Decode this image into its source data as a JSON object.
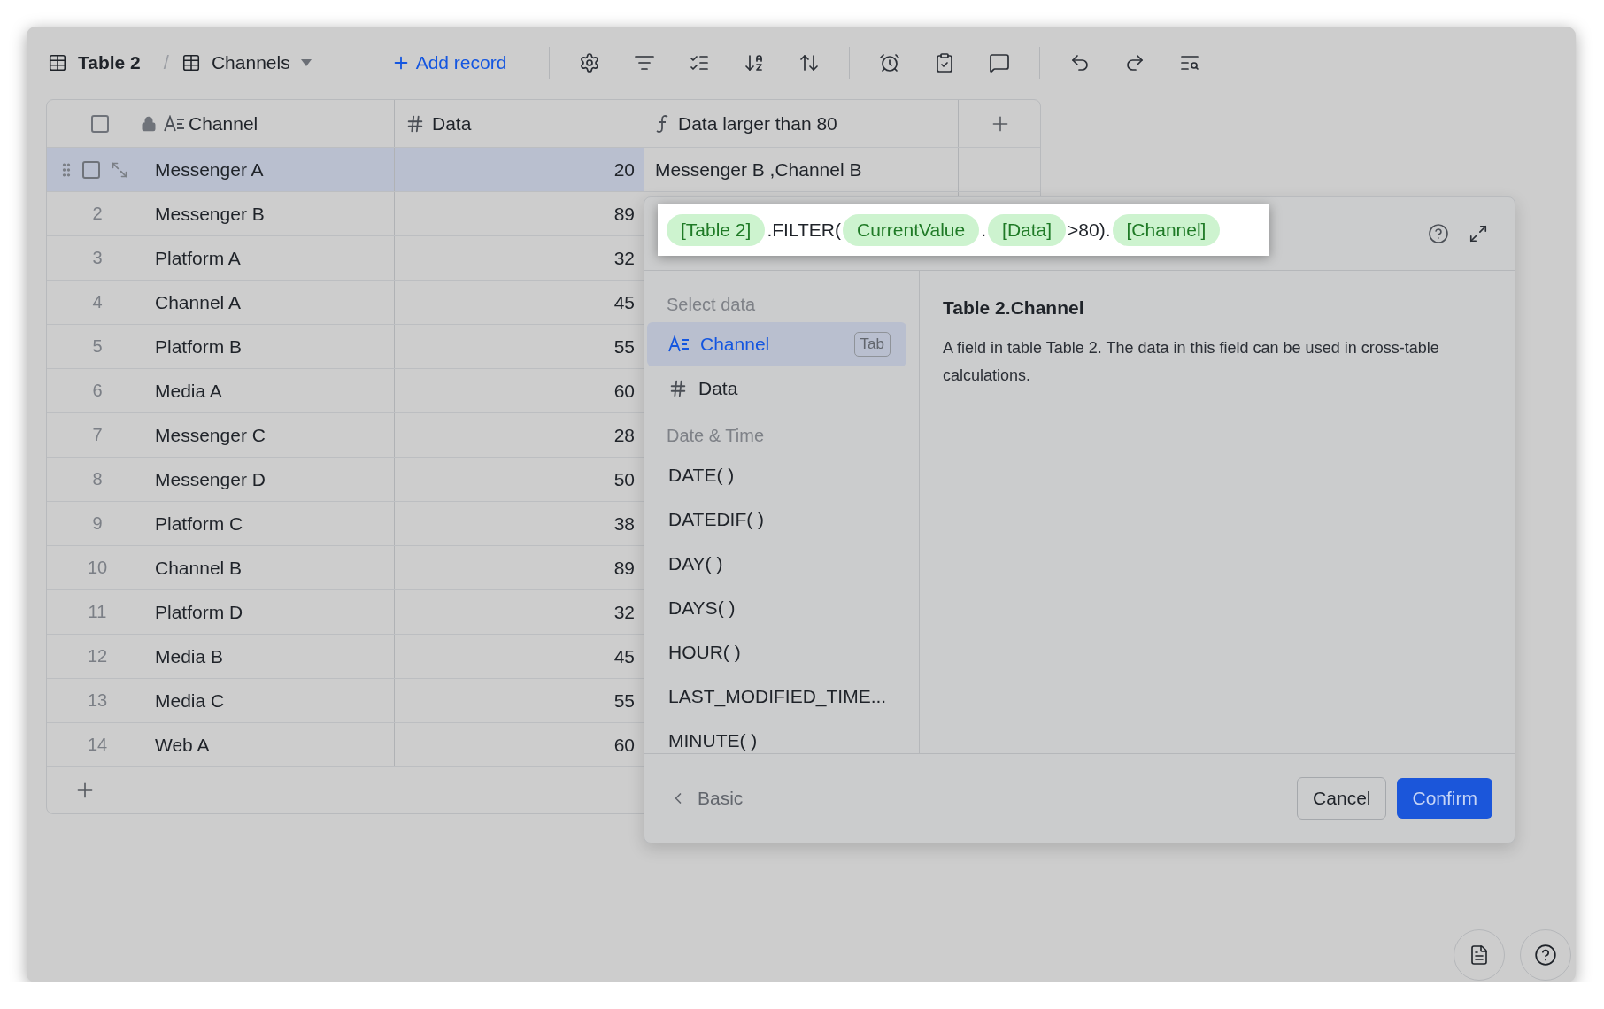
{
  "toolbar": {
    "table_name": "Table 2",
    "separator": "/",
    "view_name": "Channels",
    "add_record": "Add record"
  },
  "table": {
    "all_checked": false,
    "columns": [
      {
        "kind": "text",
        "label": "Channel"
      },
      {
        "kind": "number",
        "label": "Data"
      },
      {
        "kind": "formula",
        "label": "Data larger than 80"
      }
    ],
    "rows": [
      {
        "selected": true,
        "checked": false,
        "channel": "Messenger A",
        "data": "20",
        "formula": "Messenger B ,Channel B"
      },
      {
        "selected": false,
        "index": "2",
        "channel": "Messenger B",
        "data": "89"
      },
      {
        "selected": false,
        "index": "3",
        "channel": "Platform A",
        "data": "32"
      },
      {
        "selected": false,
        "index": "4",
        "channel": "Channel A",
        "data": "45"
      },
      {
        "selected": false,
        "index": "5",
        "channel": "Platform B",
        "data": "55"
      },
      {
        "selected": false,
        "index": "6",
        "channel": "Media A",
        "data": "60"
      },
      {
        "selected": false,
        "index": "7",
        "channel": "Messenger C",
        "data": "28"
      },
      {
        "selected": false,
        "index": "8",
        "channel": "Messenger D",
        "data": "50"
      },
      {
        "selected": false,
        "index": "9",
        "channel": "Platform C",
        "data": "38"
      },
      {
        "selected": false,
        "index": "10",
        "channel": "Channel B",
        "data": "89"
      },
      {
        "selected": false,
        "index": "11",
        "channel": "Platform D",
        "data": "32"
      },
      {
        "selected": false,
        "index": "12",
        "channel": "Media B",
        "data": "45"
      },
      {
        "selected": false,
        "index": "13",
        "channel": "Media C",
        "data": "55"
      },
      {
        "selected": false,
        "index": "14",
        "channel": "Web A",
        "data": "60"
      }
    ]
  },
  "formula_editor": {
    "tokens": [
      {
        "kind": "ref",
        "text": "[Table 2]"
      },
      {
        "kind": "plain",
        "text": ".FILTER("
      },
      {
        "kind": "ref",
        "text": "CurrentValue"
      },
      {
        "kind": "plain",
        "text": "."
      },
      {
        "kind": "ref",
        "text": "[Data]"
      },
      {
        "kind": "plain",
        "text": ">80)."
      },
      {
        "kind": "ref",
        "text": "[Channel]"
      }
    ],
    "sections": [
      {
        "title": "Select data",
        "items": [
          {
            "kind": "text-field",
            "label": "Channel",
            "shortcut": "Tab",
            "selected": true
          },
          {
            "kind": "number-field",
            "label": "Data",
            "selected": false
          }
        ]
      },
      {
        "title": "Date & Time",
        "items": [
          {
            "kind": "function",
            "label": "DATE( )",
            "selected": false
          },
          {
            "kind": "function",
            "label": "DATEDIF( )",
            "selected": false
          },
          {
            "kind": "function",
            "label": "DAY( )",
            "selected": false
          },
          {
            "kind": "function",
            "label": "DAYS( )",
            "selected": false
          },
          {
            "kind": "function",
            "label": "HOUR( )",
            "selected": false
          },
          {
            "kind": "function",
            "label": "LAST_MODIFIED_TIME...",
            "selected": false
          },
          {
            "kind": "function",
            "label": "MINUTE( )",
            "selected": false
          }
        ]
      }
    ],
    "description": {
      "title": "Table 2.Channel",
      "text": "A field in table Table 2. The data in this field can be used in cross-table calculations."
    },
    "back": "Basic",
    "cancel": "Cancel",
    "confirm": "Confirm"
  }
}
